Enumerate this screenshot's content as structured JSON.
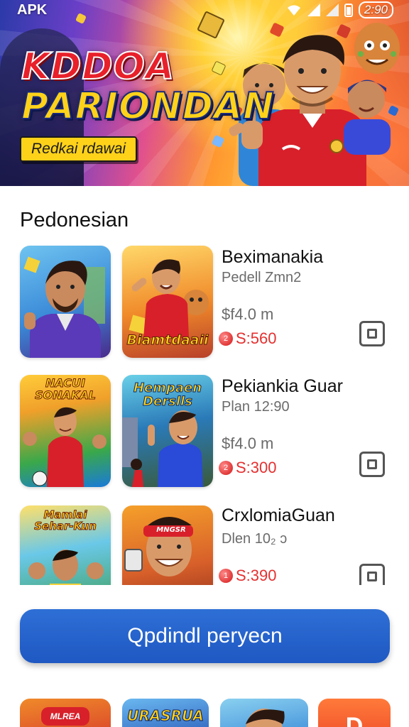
{
  "status_bar": {
    "left_label": "APK",
    "time": "2:90"
  },
  "banner": {
    "title_line1": "KDDOA",
    "title_line2": "PARIONDAN",
    "subtitle": "Redkai rdawai"
  },
  "section": {
    "title": "Pedonesian"
  },
  "items": [
    {
      "title": "Beximanakia",
      "subtitle": "Pedell Zmn2",
      "price": "$f4.0 m",
      "badge": "S:560",
      "thumb1_text": "",
      "thumb2_text": "Biamtdaaii"
    },
    {
      "title": "Pekiankia Guar",
      "subtitle": "Plan 12:90",
      "price": "$f4.0 m",
      "badge": "S:300",
      "thumb1_text": "NACUI SONAKAL",
      "thumb2_text": "Hempaen Derslls"
    },
    {
      "title": "CrxlomiaGuan",
      "subtitle": "Dlen 10₂ ɔ",
      "price": "",
      "badge": "S:390",
      "thumb1_text": "Mamlai Sehar-Kun",
      "thumb2_text": "MNGSR"
    }
  ],
  "cta": {
    "label": "Qpdindl peryecn"
  },
  "bottom_strip": {
    "thumb1_text": "MLREA",
    "thumb2_text": "URASRUA",
    "thumb4_text": "D"
  },
  "colors": {
    "cta_blue": "#2466cc",
    "badge_red": "#e53030",
    "banner_title_red": "#e8202a",
    "banner_title_yellow": "#ffd21a"
  }
}
